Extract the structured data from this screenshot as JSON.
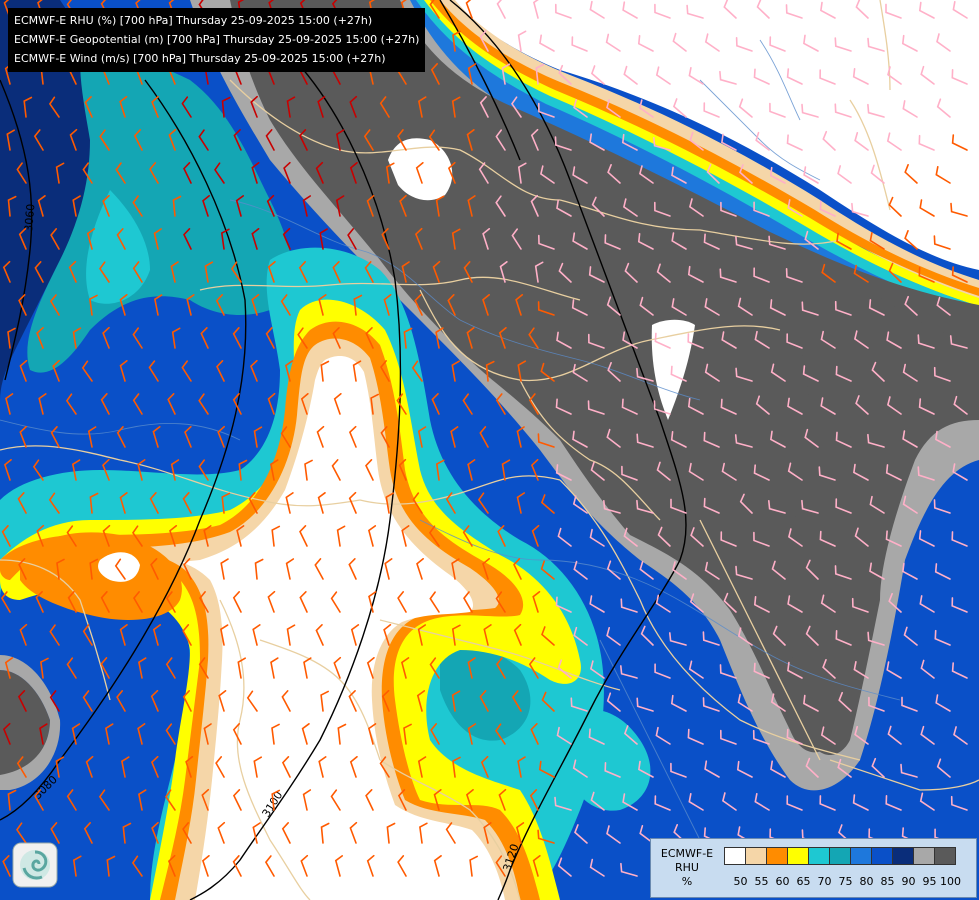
{
  "header": {
    "lines": [
      "ECMWF-E RHU (%) [700 hPa] Thursday 25-09-2025 15:00 (+27h)",
      "ECMWF-E Geopotential (m) [700 hPa] Thursday 25-09-2025 15:00 (+27h)",
      "ECMWF-E Wind (m/s) [700 hPa] Thursday 25-09-2025 15:00 (+27h)"
    ]
  },
  "contours": {
    "labels": [
      "3060",
      "3080",
      "3100",
      "3120"
    ]
  },
  "legend": {
    "model": "ECMWF-E",
    "variable": "RHU",
    "unit": "%",
    "ticks": [
      "50",
      "55",
      "60",
      "65",
      "70",
      "75",
      "80",
      "85",
      "90",
      "95",
      "100"
    ],
    "colors": [
      "#ffffff",
      "#f5d6a8",
      "#ff8c00",
      "#ffff00",
      "#1ec8d2",
      "#14a6b4",
      "#1e78dc",
      "#0a50c8",
      "#0a2d7a",
      "#a8a8a8",
      "#5a5a5a"
    ]
  },
  "colors": {
    "rh_95_100": "#5a5a5a",
    "rh_90_95": "#a8a8a8",
    "rh_85_90": "#0a2d7a",
    "rh_80_85": "#0a50c8",
    "rh_75_80": "#1e78dc",
    "rh_70_75": "#14a6b4",
    "rh_65_70": "#1ec8d2",
    "rh_60_65": "#ffff00",
    "rh_55_60": "#ff8c00",
    "rh_50_55": "#f5d6a8",
    "borders": "#e8cfa0",
    "rivers": "#5a8ccc",
    "contour": "#000000",
    "wind_barbs": [
      "#ff5a00",
      "#c80000",
      "#ffb0c8"
    ]
  },
  "logo": {
    "icon": "swirl-logo-icon"
  }
}
